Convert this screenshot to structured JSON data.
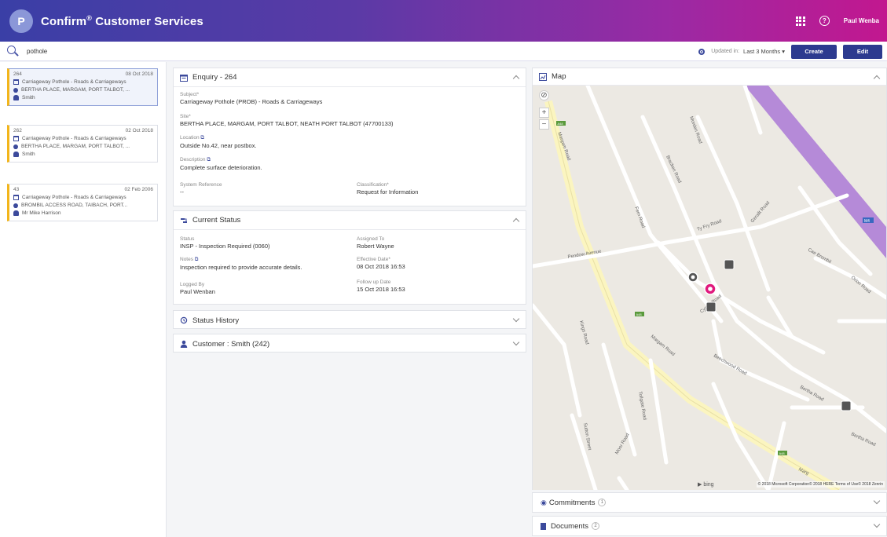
{
  "header": {
    "app_title": "Confirm",
    "app_title_sup": "®",
    "app_title_rest": " Customer Services",
    "logo_text": "P",
    "help_label": "?",
    "user_name": "Paul Wenba"
  },
  "search": {
    "value": "pothole",
    "placeholder": ""
  },
  "toolbar": {
    "updated_label": "Updated in:",
    "updated_value": "Last 3 Months",
    "create_label": "Create",
    "edit_label": "Edit"
  },
  "enquiries": [
    {
      "id": "264",
      "date": "08 Oct 2018",
      "subject": "Carriageway Pothole - Roads & Carriageways",
      "site": "BERTHA PLACE, MARGAM, PORT TALBOT, ...",
      "customer": "Smith"
    },
    {
      "id": "262",
      "date": "02 Oct 2018",
      "subject": "Carriageway Pothole - Roads & Carriageways",
      "site": "BERTHA PLACE, MARGAM, PORT TALBOT, ...",
      "customer": "Smith"
    },
    {
      "id": "43",
      "date": "02 Feb 2006",
      "subject": "Carriageway Pothole - Roads & Carriageways",
      "site": "BROMBIL ACCESS ROAD, TAIBACH, PORT...",
      "customer": "Mr Mike Harrison"
    }
  ],
  "enquiry_panel": {
    "title": "Enquiry - 264",
    "subject_label": "Subject*",
    "subject_value": "Carriageway Pothole (PROB) - Roads & Carriageways",
    "site_label": "Site*",
    "site_value": "BERTHA PLACE, MARGAM, PORT TALBOT, NEATH PORT TALBOT (47700133)",
    "location_label": "Location",
    "location_value": "Outside No.42, near postbox.",
    "description_label": "Description",
    "description_value": "Complete surface deterioration.",
    "sysref_label": "System Reference",
    "sysref_value": "--",
    "class_label": "Classification*",
    "class_value": "Request for Information"
  },
  "status_panel": {
    "title": "Current Status",
    "status_label": "Status",
    "status_value": "INSP - Inspection Required (0060)",
    "assigned_label": "Assigned To",
    "assigned_value": "Robert Wayne",
    "notes_label": "Notes",
    "notes_value": "Inspection required to provide accurate details.",
    "effective_label": "Effective Date*",
    "effective_value": "08 Oct 2018 16:53",
    "logged_label": "Logged By",
    "logged_value": "Paul Wenban",
    "followup_label": "Follow up Date",
    "followup_value": "15 Oct 2018 16:53"
  },
  "history_panel": {
    "title": "Status History"
  },
  "customer_panel": {
    "title": "Customer : Smith (242)"
  },
  "map_panel": {
    "title": "Map",
    "copyright": "© 2018 Microsoft Corporation© 2018 HERE Terms of Use© 2018 Zenrin",
    "bing": "bing",
    "roads": [
      "Margam Road",
      "Margam Road",
      "Bracken Road",
      "Fern Road",
      "Ty Fry Road",
      "Gerallt Road",
      "Pendow Avenue",
      "Bertha Road",
      "Beechwood Road",
      "Cynon Road",
      "Bertha Road",
      "Cae Brombil",
      "Kings Road",
      "Tollgate Road",
      "Sutton Street",
      "Moor Road",
      "Marg",
      "Morden Road",
      "Orion Road"
    ],
    "road_badges": [
      "A48",
      "A48",
      "A48",
      "M4"
    ]
  },
  "commitments": {
    "label": "Commitments",
    "count": "1"
  },
  "documents": {
    "label": "Documents",
    "count": "2"
  },
  "colors": {
    "header_start": "#3a3fa6",
    "header_end": "#c2178f",
    "accent": "#2c3a8f",
    "card_marker": "#f2b51b",
    "map_pin": "#e0197d"
  }
}
